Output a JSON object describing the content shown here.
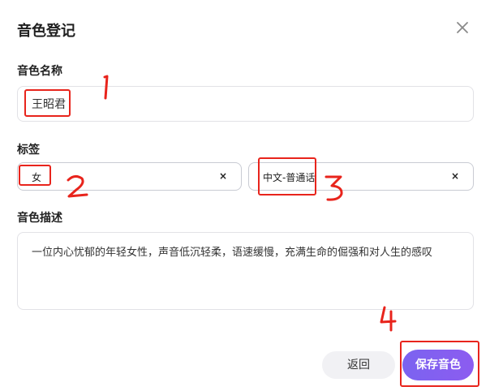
{
  "dialog": {
    "title": "音色登记",
    "close_icon": "close-icon"
  },
  "fields": {
    "name_label": "音色名称",
    "name_value": "王昭君",
    "tags_label": "标签",
    "tags": [
      {
        "text": "女",
        "remove_icon": "×"
      },
      {
        "text": "中文-普通话",
        "remove_icon": "×"
      }
    ],
    "desc_label": "音色描述",
    "desc_value": "一位内心忧郁的年轻女性，声音低沉轻柔，语速缓慢，充满生命的倔强和对人生的感叹"
  },
  "actions": {
    "back_label": "返回",
    "save_label": "保存音色"
  },
  "annotations": {
    "color": "#e8241c",
    "numbers": [
      "1",
      "2",
      "3",
      "4"
    ]
  }
}
